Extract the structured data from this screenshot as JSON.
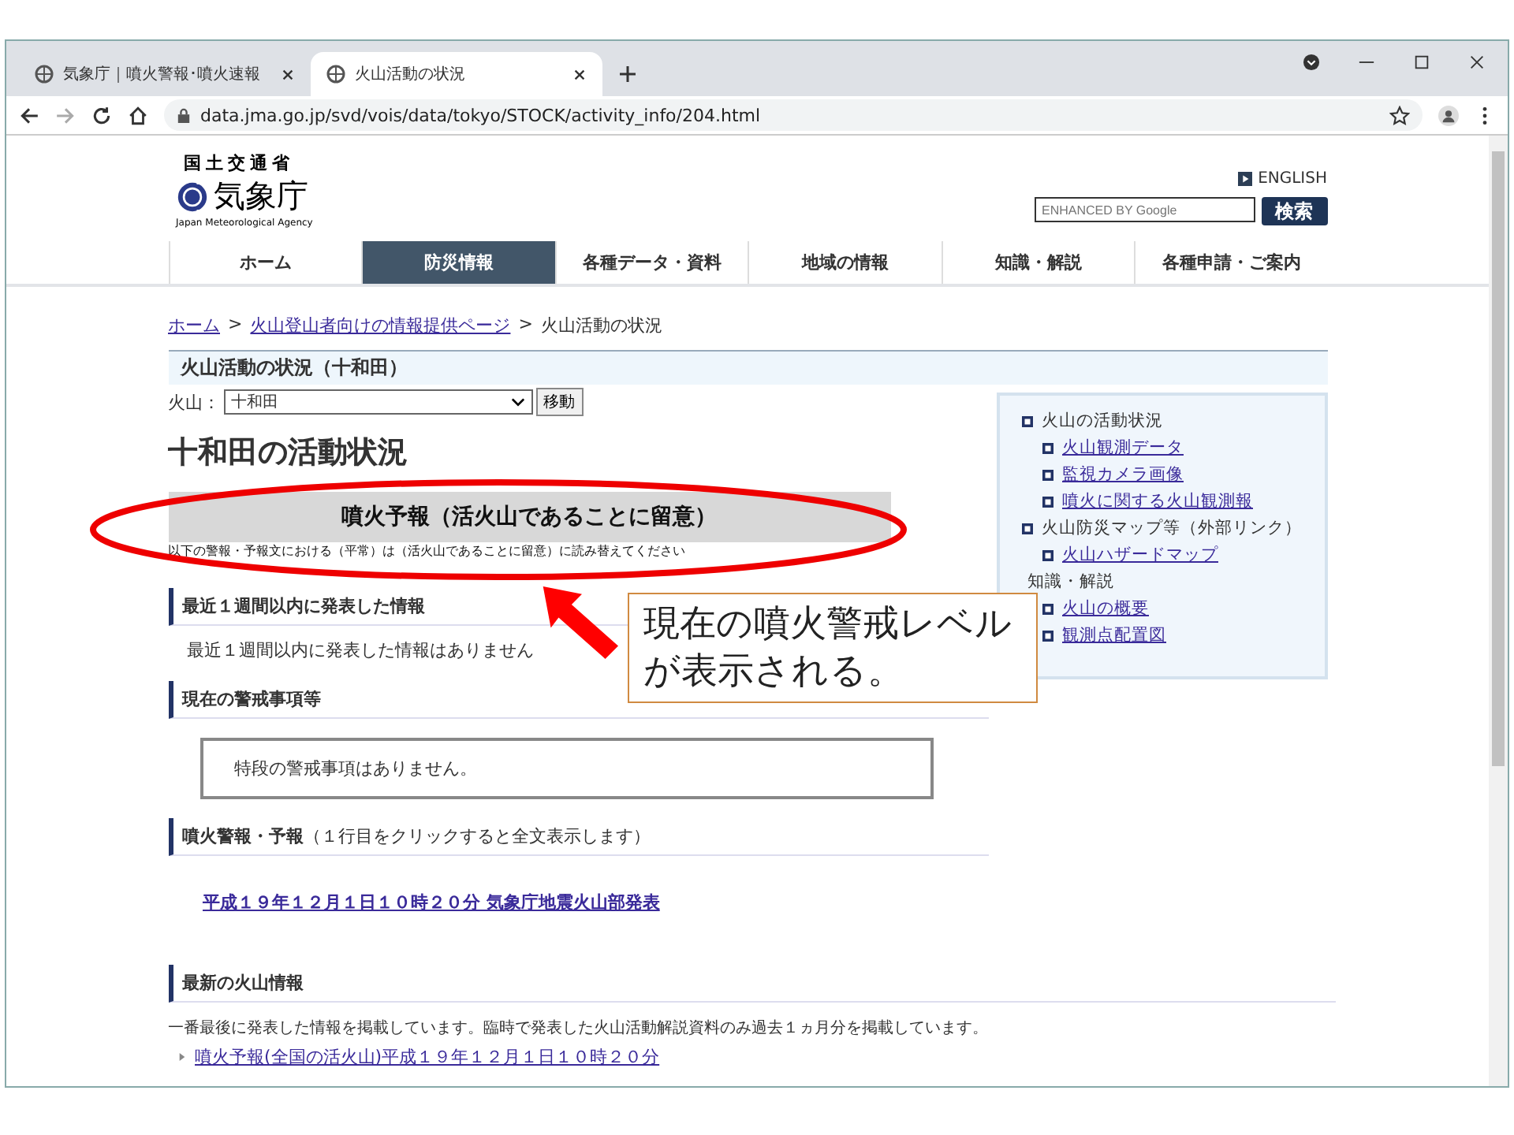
{
  "browser": {
    "tabs": [
      {
        "title": "気象庁｜噴火警報･噴火速報",
        "selected": false
      },
      {
        "title": "火山活動の状況",
        "selected": true
      }
    ],
    "url": "data.jma.go.jp/svd/vois/data/tokyo/STOCK/activity_info/204.html"
  },
  "header": {
    "ministry": "国土交通省",
    "agency": "気象庁",
    "agency_en": "Japan Meteorological Agency",
    "english_link": "ENGLISH",
    "search_placeholder": "ENHANCED BY Google",
    "search_button": "検索"
  },
  "nav": [
    {
      "label": "ホーム",
      "selected": false
    },
    {
      "label": "防災情報",
      "selected": true
    },
    {
      "label": "各種データ・資料",
      "selected": false
    },
    {
      "label": "地域の情報",
      "selected": false
    },
    {
      "label": "知識・解説",
      "selected": false
    },
    {
      "label": "各種申請・ご案内",
      "selected": false
    }
  ],
  "breadcrumb": {
    "links": [
      "ホーム",
      "火山登山者向けの情報提供ページ"
    ],
    "separator": ">",
    "current": "火山活動の状況"
  },
  "page_title": "火山活動の状況（十和田）",
  "volcano_select": {
    "label": "火山：",
    "value": "十和田",
    "button": "移動"
  },
  "heading": "十和田の活動状況",
  "level_banner": "噴火予報（活火山であることに留意）",
  "banner_note": "以下の警報・予報文における（平常）は（活火山であることに留意）に読み替えてください",
  "sections": [
    {
      "title": "最近１週間以内に発表した情報",
      "kind": "text",
      "text": "最近１週間以内に発表した情報はありません"
    },
    {
      "title": "現在の警戒事項等",
      "kind": "boxed",
      "text": "特段の警戒事項はありません。"
    },
    {
      "title": "噴火警報・予報",
      "subtitle": "（１行目をクリックすると全文表示します）",
      "kind": "link",
      "text": "平成１９年１２月１日１０時２０分 気象庁地震火山部発表"
    },
    {
      "title": "最新の火山情報",
      "kind": "list",
      "text": "一番最後に発表した情報を掲載しています。臨時で発表した火山活動解説資料のみ過去１ヵ月分を掲載しています。",
      "items": [
        "噴火予報(全国の活火山)平成１９年１２月１日１０時２０分"
      ]
    }
  ],
  "sidebar": [
    {
      "label": "火山の活動状況",
      "bullet": true,
      "children": [
        "火山観測データ",
        "監視カメラ画像",
        "噴火に関する火山観測報"
      ]
    },
    {
      "label": "火山防災マップ等（外部リンク）",
      "bullet": true,
      "children": [
        "火山ハザードマップ"
      ]
    },
    {
      "label": "知識・解説",
      "bullet": false,
      "children": [
        "火山の概要",
        "観測点配置図"
      ]
    }
  ],
  "callout": "現在の噴火警戒レベルが表示される。"
}
